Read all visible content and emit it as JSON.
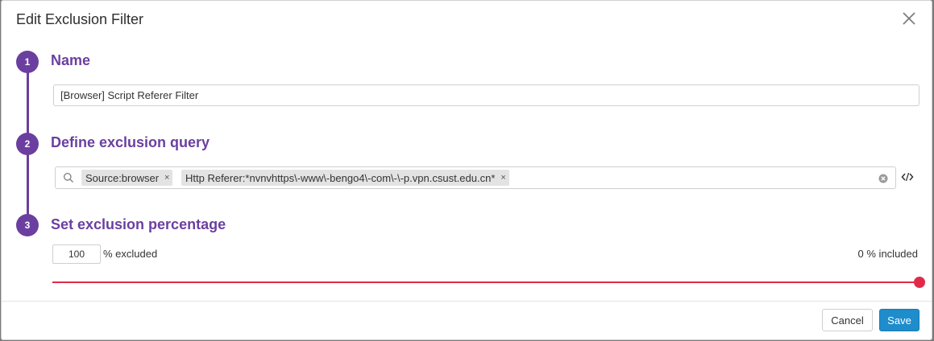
{
  "dialog": {
    "title": "Edit Exclusion Filter"
  },
  "steps": [
    {
      "number": "1",
      "title": "Name"
    },
    {
      "number": "2",
      "title": "Define exclusion query"
    },
    {
      "number": "3",
      "title": "Set exclusion percentage"
    }
  ],
  "name_field": {
    "value": "[Browser] Script Referer Filter"
  },
  "query": {
    "pills": [
      {
        "label": "Source:browser",
        "remove": "×"
      },
      {
        "label": "Http Referer:*nvnvhttps\\-www\\-bengo4\\-com\\-\\-p.vpn.csust.edu.cn*",
        "remove": "×"
      }
    ]
  },
  "exclusion": {
    "value": "100",
    "excluded_label": "% excluded",
    "included_label": "0 % included",
    "slider_fraction": 1.0
  },
  "footer": {
    "cancel_label": "Cancel",
    "save_label": "Save"
  },
  "colors": {
    "accent_purple": "#6b3fa0",
    "slider_red": "#e02a48",
    "save_blue": "#1f8ccc"
  },
  "icons": {
    "close": "close-icon",
    "search": "search-icon",
    "clear": "clear-circle-icon",
    "code": "code-icon"
  }
}
